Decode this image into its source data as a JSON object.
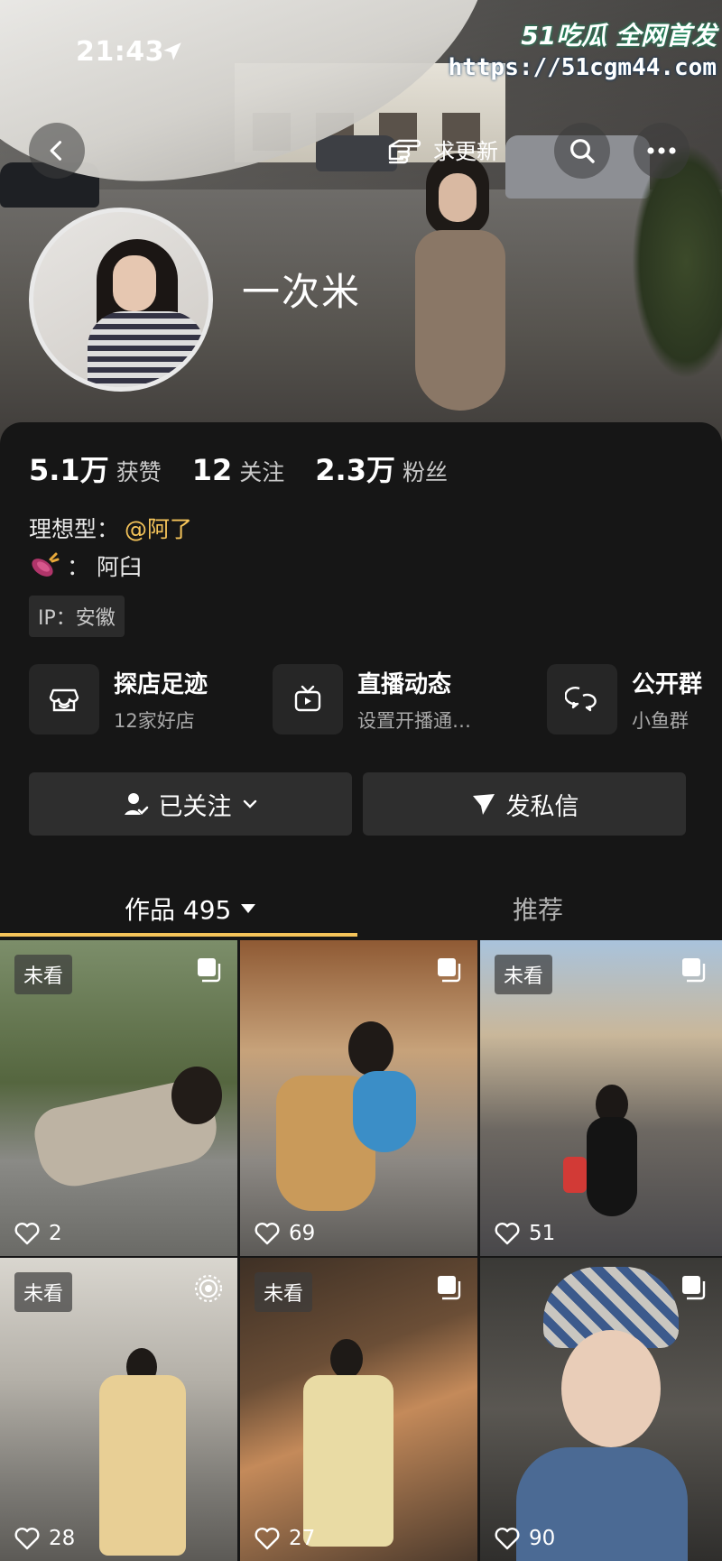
{
  "status_bar": {
    "time": "21:43"
  },
  "watermark": {
    "brand": "51吃瓜 全网首发",
    "url": "https://51cgm44.com"
  },
  "header": {
    "update_label": "求更新"
  },
  "profile": {
    "name": "一次米",
    "stats": [
      {
        "value": "5.1万",
        "label": "获赞"
      },
      {
        "value": "12",
        "label": "关注"
      },
      {
        "value": "2.3万",
        "label": "粉丝"
      }
    ],
    "bio": {
      "ideal_prefix": "理想型：",
      "ideal_mention": "@阿了",
      "potato_line": "：  阿臼",
      "ip": "IP：安徽"
    }
  },
  "quick_links": [
    {
      "title": "探店足迹",
      "subtitle": "12家好店",
      "icon": "store-icon"
    },
    {
      "title": "直播动态",
      "subtitle": "设置开播通…",
      "icon": "tv-icon"
    },
    {
      "title": "公开群",
      "subtitle": "小鱼群",
      "icon": "chat-bubbles-icon"
    }
  ],
  "actions": {
    "follow": "已关注",
    "message": "发私信"
  },
  "tabs": {
    "works_label": "作品 495",
    "recommend_label": "推荐"
  },
  "unseen_label": "未看",
  "posts": [
    {
      "likes": "2",
      "unseen": true,
      "badge": "multi"
    },
    {
      "likes": "69",
      "unseen": false,
      "badge": "multi"
    },
    {
      "likes": "51",
      "unseen": true,
      "badge": "multi"
    },
    {
      "likes": "28",
      "unseen": true,
      "badge": "live"
    },
    {
      "likes": "27",
      "unseen": true,
      "badge": "multi"
    },
    {
      "likes": "90",
      "unseen": false,
      "badge": "multi"
    }
  ],
  "colors": {
    "accent": "#f5c45a",
    "panel": "#161616",
    "button": "#2e2e2e"
  }
}
